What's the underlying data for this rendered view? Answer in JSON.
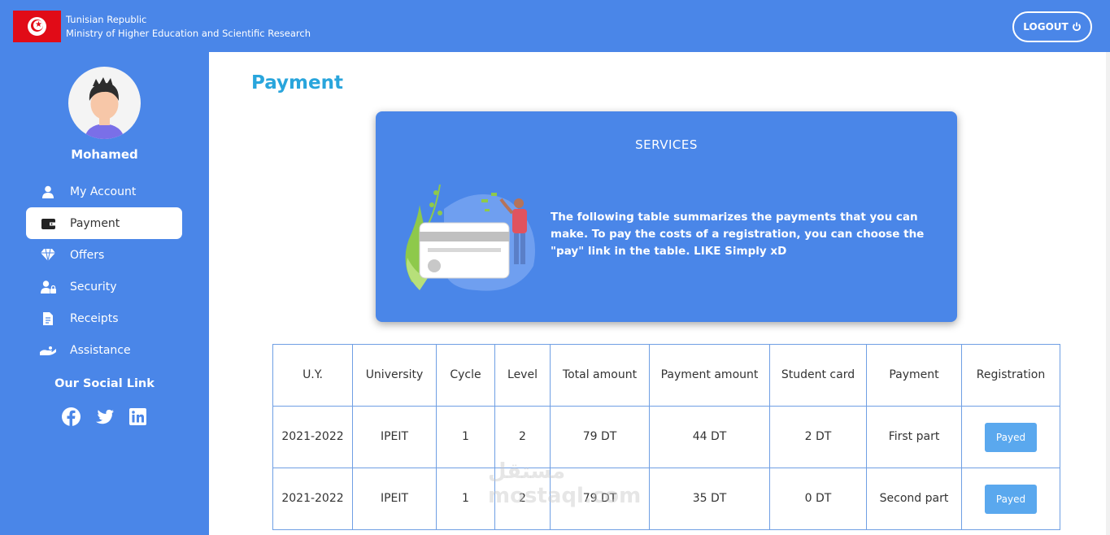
{
  "header": {
    "country": "Tunisian Republic",
    "ministry": "Ministry of Higher Education and Scientific Research",
    "logout_label": "LOGOUT"
  },
  "sidebar": {
    "username": "Mohamed",
    "items": [
      {
        "label": "My Account",
        "icon": "user-icon"
      },
      {
        "label": "Payment",
        "icon": "wallet-icon",
        "active": true
      },
      {
        "label": "Offers",
        "icon": "diamond-icon"
      },
      {
        "label": "Security",
        "icon": "user-lock-icon"
      },
      {
        "label": "Receipts",
        "icon": "receipt-icon"
      },
      {
        "label": "Assistance",
        "icon": "hand-icon"
      }
    ],
    "social_title": "Our Social Link",
    "social": [
      "facebook-icon",
      "twitter-icon",
      "linkedin-icon"
    ]
  },
  "main": {
    "title": "Payment",
    "card": {
      "title": "SERVICES",
      "text": "The following table summarizes the payments that you can make. To pay the costs of a registration, you can choose the \"pay\" link in the table. LIKE Simply xD"
    },
    "table": {
      "headers": [
        "U.Y.",
        "University",
        "Cycle",
        "Level",
        "Total amount",
        "Payment amount",
        "Student card",
        "Payment",
        "Registration"
      ],
      "rows": [
        [
          "2021-2022",
          "IPEIT",
          "1",
          "2",
          "79 DT",
          "44 DT",
          "2 DT",
          "First part",
          "Payed"
        ],
        [
          "2021-2022",
          "IPEIT",
          "1",
          "2",
          "79 DT",
          "35 DT",
          "0 DT",
          "Second part",
          "Payed"
        ]
      ]
    }
  },
  "watermark": {
    "line1": "مستقل",
    "line2": "mostaql.com"
  },
  "colors": {
    "primary": "#4a86e8",
    "title": "#29a5dc",
    "button": "#5aa8ee",
    "flag": "#e10b17"
  }
}
